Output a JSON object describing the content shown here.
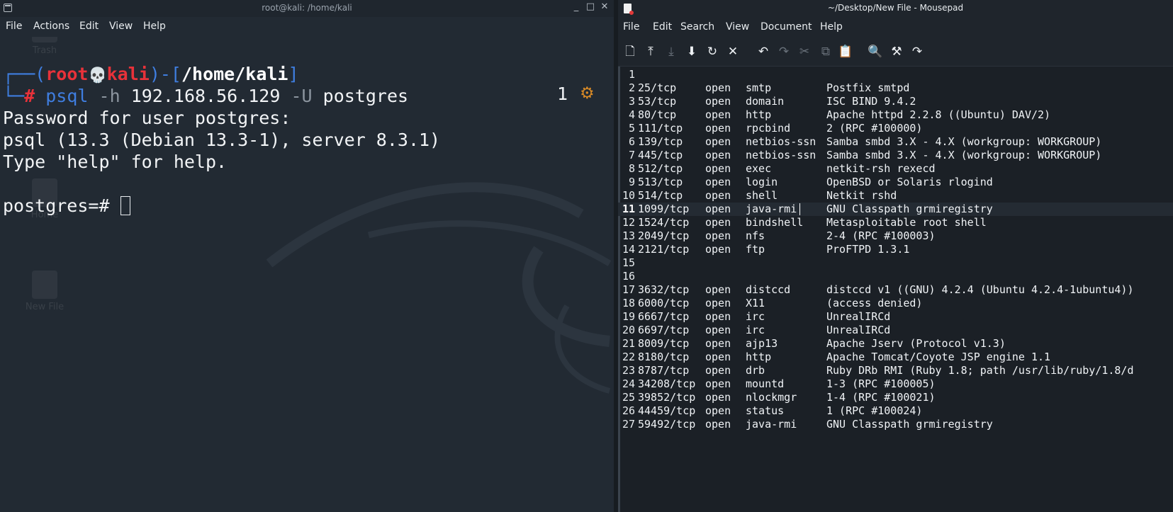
{
  "terminal": {
    "title": "root@kali: /home/kali",
    "window_controls": [
      "_",
      "□",
      "✕"
    ],
    "menu": [
      "File",
      "Actions",
      "Edit",
      "View",
      "Help"
    ],
    "desktop_ghost_icons": [
      "Trash",
      "Home",
      "New File"
    ],
    "prompt": {
      "open": "┌──(",
      "user": "root",
      "skull": "💀",
      "host": "kali",
      "close": ")-[",
      "path": "/home/kali",
      "end": "]",
      "line2_prefix": "└─",
      "hash": "#",
      "cmd": "psql",
      "flag1": "-h",
      "arg1": "192.168.56.129",
      "flag2": "-U",
      "arg2": "postgres"
    },
    "right_status_number": "1",
    "right_status_icon": "⚙",
    "output": [
      "Password for user postgres:",
      "psql (13.3 (Debian 13.3-1), server 8.3.1)",
      "Type \"help\" for help."
    ],
    "current_prompt": "postgres=# "
  },
  "mousepad": {
    "title": "~/Desktop/New File - Mousepad",
    "menu": [
      "File",
      "Edit",
      "Search",
      "View",
      "Document",
      "Help"
    ],
    "toolbar": [
      {
        "name": "new-document-icon",
        "glyph": "🗋",
        "enabled": true
      },
      {
        "name": "open-icon",
        "glyph": "⤒",
        "enabled": true
      },
      {
        "name": "save-icon",
        "glyph": "⤓",
        "enabled": false
      },
      {
        "name": "save-as-icon",
        "glyph": "⬇",
        "enabled": true
      },
      {
        "name": "reload-icon",
        "glyph": "↻",
        "enabled": true
      },
      {
        "name": "close-icon",
        "glyph": "✕",
        "enabled": true
      },
      {
        "name": "undo-icon",
        "glyph": "↶",
        "enabled": true
      },
      {
        "name": "redo-icon",
        "glyph": "↷",
        "enabled": false
      },
      {
        "name": "cut-icon",
        "glyph": "✂",
        "enabled": false
      },
      {
        "name": "copy-icon",
        "glyph": "⧉",
        "enabled": false
      },
      {
        "name": "paste-icon",
        "glyph": "📋",
        "enabled": true
      },
      {
        "name": "search-icon",
        "glyph": "🔍",
        "enabled": true
      },
      {
        "name": "search-replace-icon",
        "glyph": "⚒",
        "enabled": true
      },
      {
        "name": "go-to-line-icon",
        "glyph": "↷",
        "enabled": true
      }
    ],
    "current_line": 11,
    "lines": [
      {
        "n": "1",
        "port": "",
        "state": "",
        "service": "",
        "version": ""
      },
      {
        "n": "2",
        "port": "25/tcp",
        "state": "open",
        "service": "smtp",
        "version": "Postfix smtpd"
      },
      {
        "n": "3",
        "port": "53/tcp",
        "state": "open",
        "service": "domain",
        "version": "ISC BIND 9.4.2"
      },
      {
        "n": "4",
        "port": "80/tcp",
        "state": "open",
        "service": "http",
        "version": "Apache httpd 2.2.8 ((Ubuntu) DAV/2)"
      },
      {
        "n": "5",
        "port": "111/tcp",
        "state": "open",
        "service": "rpcbind",
        "version": "2 (RPC #100000)"
      },
      {
        "n": "6",
        "port": "139/tcp",
        "state": "open",
        "service": "netbios-ssn",
        "version": "Samba smbd 3.X - 4.X (workgroup: WORKGROUP)"
      },
      {
        "n": "7",
        "port": "445/tcp",
        "state": "open",
        "service": "netbios-ssn",
        "version": "Samba smbd 3.X - 4.X (workgroup: WORKGROUP)"
      },
      {
        "n": "8",
        "port": "512/tcp",
        "state": "open",
        "service": "exec",
        "version": "netkit-rsh rexecd"
      },
      {
        "n": "9",
        "port": "513/tcp",
        "state": "open",
        "service": "login",
        "version": "OpenBSD or Solaris rlogind"
      },
      {
        "n": "10",
        "port": "514/tcp",
        "state": "open",
        "service": "shell",
        "version": "Netkit rshd"
      },
      {
        "n": "11",
        "port": "1099/tcp",
        "state": "open",
        "service": "java-rmi",
        "version": "GNU Classpath grmiregistry"
      },
      {
        "n": "12",
        "port": "1524/tcp",
        "state": "open",
        "service": "bindshell",
        "version": "Metasploitable root shell"
      },
      {
        "n": "13",
        "port": "2049/tcp",
        "state": "open",
        "service": "nfs",
        "version": "2-4 (RPC #100003)"
      },
      {
        "n": "14",
        "port": "2121/tcp",
        "state": "open",
        "service": "ftp",
        "version": "ProFTPD 1.3.1"
      },
      {
        "n": "15",
        "port": "",
        "state": "",
        "service": "",
        "version": ""
      },
      {
        "n": "16",
        "port": "",
        "state": "",
        "service": "",
        "version": ""
      },
      {
        "n": "17",
        "port": "3632/tcp",
        "state": "open",
        "service": "distccd",
        "version": "distccd v1 ((GNU) 4.2.4 (Ubuntu 4.2.4-1ubuntu4))"
      },
      {
        "n": "18",
        "port": "6000/tcp",
        "state": "open",
        "service": "X11",
        "version": "(access denied)"
      },
      {
        "n": "19",
        "port": "6667/tcp",
        "state": "open",
        "service": "irc",
        "version": "UnrealIRCd"
      },
      {
        "n": "20",
        "port": "6697/tcp",
        "state": "open",
        "service": "irc",
        "version": "UnrealIRCd"
      },
      {
        "n": "21",
        "port": "8009/tcp",
        "state": "open",
        "service": "ajp13",
        "version": "Apache Jserv (Protocol v1.3)"
      },
      {
        "n": "22",
        "port": "8180/tcp",
        "state": "open",
        "service": "http",
        "version": "Apache Tomcat/Coyote JSP engine 1.1"
      },
      {
        "n": "23",
        "port": "8787/tcp",
        "state": "open",
        "service": "drb",
        "version": "Ruby DRb RMI (Ruby 1.8; path /usr/lib/ruby/1.8/d"
      },
      {
        "n": "24",
        "port": "34208/tcp",
        "state": "open",
        "service": "mountd",
        "version": "1-3 (RPC #100005)"
      },
      {
        "n": "25",
        "port": "39852/tcp",
        "state": "open",
        "service": "nlockmgr",
        "version": "1-4 (RPC #100021)"
      },
      {
        "n": "26",
        "port": "44459/tcp",
        "state": "open",
        "service": "status",
        "version": "1 (RPC #100024)"
      },
      {
        "n": "27",
        "port": "59492/tcp",
        "state": "open",
        "service": "java-rmi",
        "version": "GNU Classpath grmiregistry"
      }
    ]
  }
}
